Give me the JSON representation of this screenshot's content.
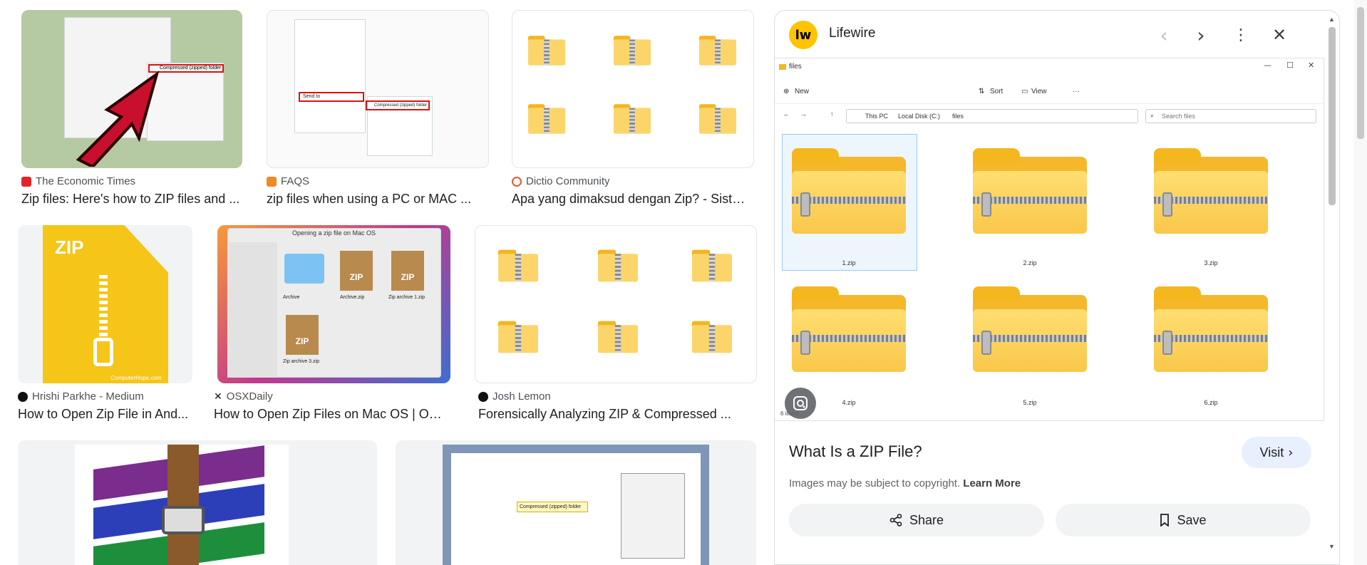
{
  "results": [
    {
      "source": "The Economic Times",
      "title": "Zip files: Here's how to ZIP files and ...",
      "fav_color": "#e2252b"
    },
    {
      "source": "FAQS",
      "title": "zip files when using a PC or MAC ...",
      "fav_color": "#f08a24"
    },
    {
      "source": "Dictio Community",
      "title": "Apa yang dimaksud dengan Zip? - Siste...",
      "fav_color": "#e9582b"
    },
    {
      "source": "Hrishi Parkhe - Medium",
      "title": "How to Open Zip File in And...",
      "fav_color": "#111111"
    },
    {
      "source": "OSXDaily",
      "title": "How to Open Zip Files on Mac OS | OSX...",
      "fav_color": "#111111"
    },
    {
      "source": "Josh Lemon",
      "title": "Forensically Analyzing ZIP & Compressed ...",
      "fav_color": "#111111"
    }
  ],
  "thumb_text": {
    "zip_badge": "ZIP",
    "computerhope": "ComputerHope.com",
    "osx_window": "Opening a zip file on Mac OS",
    "osx_items": [
      "Archive",
      "Archive.zip",
      "Zip archive 1.zip",
      "Zip archive 3.zip"
    ],
    "ctx_send_to": "Send to",
    "ctx_compressed": "Compressed (zipped) folder",
    "compressed_label": "Compressed (zipped) folder"
  },
  "panel": {
    "site_name": "Lifewire",
    "logo_text": "lw",
    "image_title": "What Is a ZIP File?",
    "visit_label": "Visit",
    "copyright_text": "Images may be subject to copyright.",
    "learn_more": "Learn More",
    "share_label": "Share",
    "save_label": "Save"
  },
  "explorer": {
    "window_title": "files",
    "toolbar": {
      "new": "New",
      "sort": "Sort",
      "view": "View"
    },
    "breadcrumb": [
      "This PC",
      "Local Disk (C:)",
      "files"
    ],
    "search_placeholder": "Search files",
    "files": [
      "1.zip",
      "2.zip",
      "3.zip",
      "4.zip",
      "5.zip",
      "6.zip"
    ],
    "status": "6 items"
  }
}
